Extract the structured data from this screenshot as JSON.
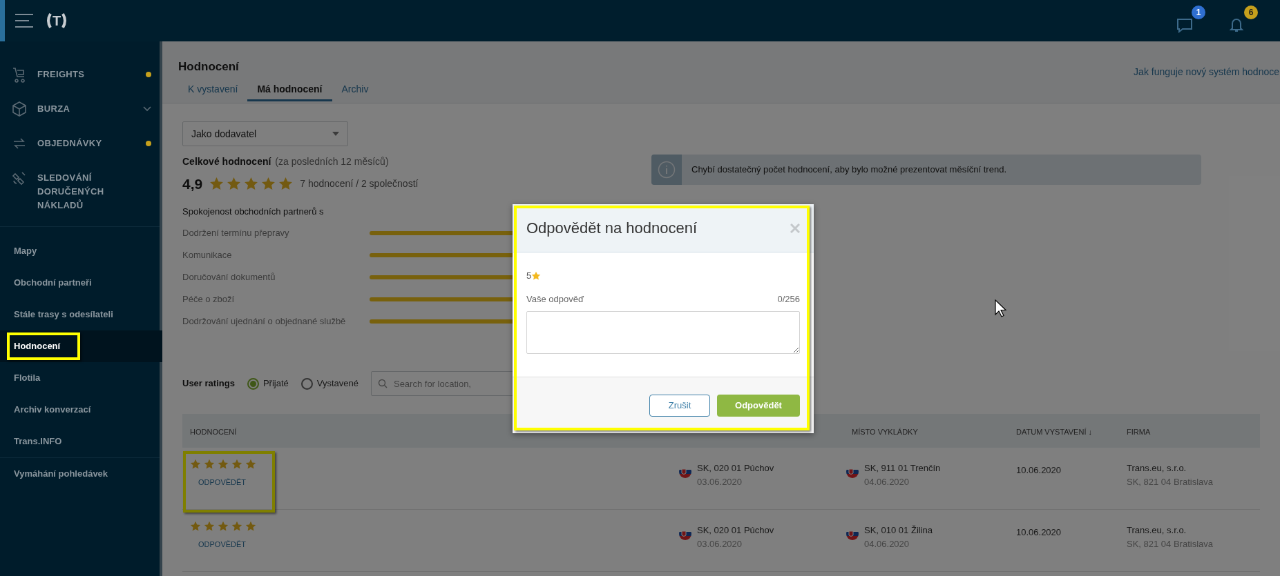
{
  "topbar": {
    "logo": "T",
    "messages_badge": "1",
    "notifications_badge": "6"
  },
  "sidebar": {
    "modules": [
      {
        "label": "FREIGHTS",
        "kind": "dot"
      },
      {
        "label": "BURZA",
        "kind": "expand"
      },
      {
        "label": "OBJEDNÁVKY",
        "kind": "dot"
      },
      {
        "label": "SLEDOVÁNÍ DORUČENÝCH NÁKLADŮ",
        "kind": "plain"
      }
    ],
    "links": [
      {
        "label": "Mapy",
        "selected": false,
        "highlighted": false
      },
      {
        "label": "Obchodní partneři",
        "selected": false,
        "highlighted": false
      },
      {
        "label": "Stále trasy s odesílateli",
        "selected": false,
        "highlighted": false
      },
      {
        "label": "Hodnocení",
        "selected": true,
        "highlighted": true
      },
      {
        "label": "Flotila",
        "selected": false,
        "highlighted": false
      },
      {
        "label": "Archiv konverzací",
        "selected": false,
        "highlighted": false
      },
      {
        "label": "Trans.INFO",
        "selected": false,
        "highlighted": false
      }
    ],
    "bottom_links": [
      {
        "label": "Vymáhání pohledávek",
        "selected": false,
        "highlighted": false
      }
    ]
  },
  "page": {
    "title": "Hodnocení",
    "help_link": "Jak funguje nový systém hodnoce",
    "tabs": [
      {
        "label": "K vystavení",
        "selected": false
      },
      {
        "label": "Má hodnocení",
        "selected": true
      },
      {
        "label": "Archiv",
        "selected": false
      }
    ],
    "role_select": "Jako dodavatel",
    "summary": {
      "label": "Celkové hodnocení",
      "period": "(za posledních 12 měsíců)",
      "score": "4,9",
      "stars": 5,
      "counts": "7 hodnocení / 2 společností"
    },
    "info": "Chybí dostatečný počet hodnocení, aby bylo možné prezentovat měsíční trend.",
    "criteria_title": "Spokojenost obchodních partnerů s",
    "criteria": [
      {
        "label": "Dodržení termínu přepravy",
        "level": 1
      },
      {
        "label": "Komunikace",
        "level": 1
      },
      {
        "label": "Doručování dokumentů",
        "level": 1
      },
      {
        "label": "Péče o zboží",
        "level": 1
      },
      {
        "label": "Dodržování ujednání o objednané službě",
        "level": 1
      }
    ]
  },
  "ratings": {
    "title": "User ratings",
    "filters": [
      {
        "label": "Přijaté",
        "selected": true
      },
      {
        "label": "Vystavené",
        "selected": false
      }
    ],
    "search": {
      "placeholder": "Search for location,"
    },
    "columns": [
      "HODNOCENÍ",
      "",
      "",
      "MÍSTO VYKLÁDKY",
      "DATUM VYSTAVENÍ ↓",
      "FIRMA"
    ],
    "rows": [
      {
        "stars": 5,
        "action": "ODPOVĚDĚT",
        "highlighted": true,
        "loading": "SK, 020 01 Púchov",
        "loading_date": "03.06.2020",
        "unloading": "SK, 911 01 Trenčín",
        "unloading_date": "04.06.2020",
        "issued": "10.06.2020",
        "company": "Trans.eu, s.r.o.",
        "company_address": "SK, 821 04 Bratislava"
      },
      {
        "stars": 5,
        "action": "ODPOVĚDĚT",
        "highlighted": false,
        "loading": "SK, 020 01 Púchov",
        "loading_date": "03.06.2020",
        "unloading": "SK, 010 01 Žilina",
        "unloading_date": "04.06.2020",
        "issued": "10.06.2020",
        "company": "Trans.eu, s.r.o.",
        "company_address": "SK, 821 04 Bratislava"
      }
    ]
  },
  "modal": {
    "title": "Odpovědět na hodnocení",
    "highlighted": true,
    "rating": "5",
    "field_label": "Vaše odpověď",
    "counter": "0/256",
    "buttons": [
      {
        "label": "Zrušit",
        "kind": "secondary"
      },
      {
        "label": "Odpovědět",
        "kind": "primary"
      }
    ]
  }
}
